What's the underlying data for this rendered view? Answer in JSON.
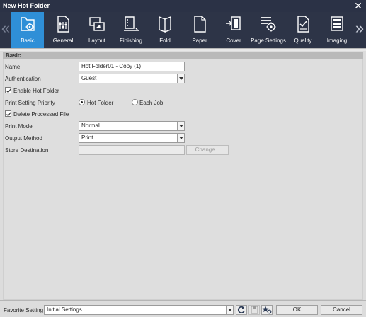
{
  "window": {
    "title": "New Hot Folder"
  },
  "tabs": [
    {
      "id": "basic",
      "label": "Basic",
      "icon": "folder-gear-icon",
      "active": true
    },
    {
      "id": "general",
      "label": "General",
      "icon": "document-sliders-icon",
      "active": false
    },
    {
      "id": "layout",
      "label": "Layout",
      "icon": "layout-pages-icon",
      "active": false
    },
    {
      "id": "finishing",
      "label": "Finishing",
      "icon": "finishing-tray-icon",
      "active": false
    },
    {
      "id": "fold",
      "label": "Fold",
      "icon": "fold-icon",
      "active": false
    },
    {
      "id": "paper",
      "label": "Paper",
      "icon": "paper-icon",
      "active": false
    },
    {
      "id": "cover",
      "label": "Cover",
      "icon": "cover-insert-icon",
      "active": false
    },
    {
      "id": "page_settings",
      "label": "Page Settings",
      "icon": "page-settings-icon",
      "active": false
    },
    {
      "id": "quality",
      "label": "Quality",
      "icon": "quality-check-icon",
      "active": false
    },
    {
      "id": "imaging",
      "label": "Imaging",
      "icon": "imaging-icon",
      "active": false
    }
  ],
  "section": {
    "title": "Basic"
  },
  "form": {
    "name": {
      "label": "Name",
      "value": "Hot Folder01 - Copy (1)"
    },
    "authentication": {
      "label": "Authentication",
      "value": "Guest"
    },
    "enable_hot_folder": {
      "label": "Enable Hot Folder",
      "checked": true
    },
    "print_setting_priority": {
      "label": "Print Setting Priority",
      "options": [
        "Hot Folder",
        "Each Job"
      ],
      "selected": "Hot Folder"
    },
    "delete_processed_file": {
      "label": "Delete Processed File",
      "checked": true
    },
    "print_mode": {
      "label": "Print Mode",
      "value": "Normal"
    },
    "output_method": {
      "label": "Output Method",
      "value": "Print"
    },
    "store_destination": {
      "label": "Store Destination",
      "value": "",
      "change_label": "Change..."
    }
  },
  "footer": {
    "favorite_label": "Favorite Setting",
    "favorite_value": "Initial Settings",
    "ok_label": "OK",
    "cancel_label": "Cancel"
  },
  "colors": {
    "titlebar": "#2b3246",
    "active_tab": "#2f8fd7",
    "panel": "#dcdcdc"
  }
}
